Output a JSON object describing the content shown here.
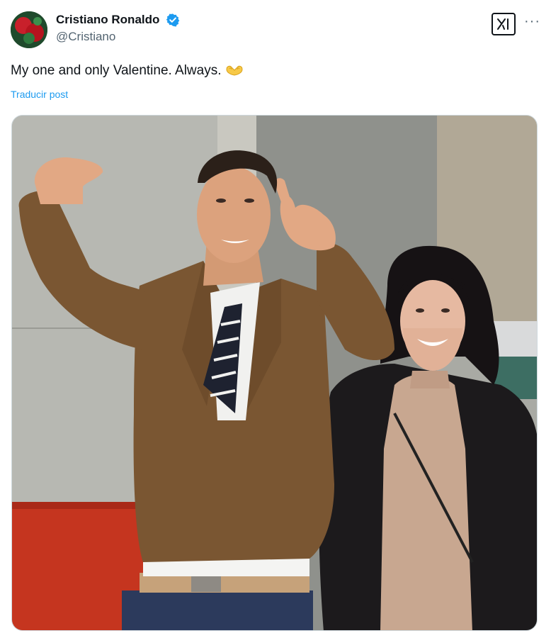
{
  "author": {
    "display_name": "Cristiano Ronaldo",
    "handle": "@Cristiano",
    "verified": true,
    "verified_icon": "verified-badge-icon",
    "verified_color": "#1d9bf0"
  },
  "tweet": {
    "text": "My one and only Valentine. Always.",
    "emoji_icon": "heart-hands-icon",
    "translate_label": "Traducir post"
  },
  "actions": {
    "grok_icon": "grok-icon",
    "more_icon": "more-options-icon",
    "more_label": "···"
  },
  "colors": {
    "link": "#1d9bf0",
    "secondary_text": "#536471",
    "primary_text": "#0f1419"
  }
}
